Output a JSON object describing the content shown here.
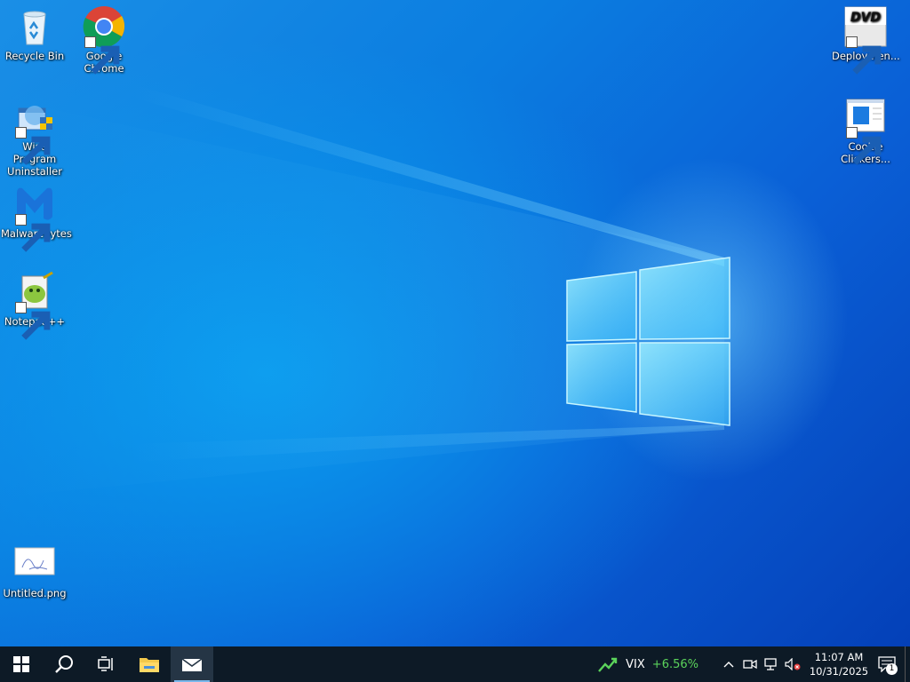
{
  "desktop": {
    "icons_left": [
      {
        "label": "Recycle Bin"
      },
      {
        "label": "Google Chrome"
      },
      {
        "label": "Wise Program Uninstaller"
      },
      {
        "label": "Malwarebytes"
      },
      {
        "label": "Notepad++"
      },
      {
        "label": "Untitled.png"
      }
    ],
    "icons_right": [
      {
        "label": "Deploymen..."
      },
      {
        "label": "Cookie Clickers..."
      }
    ]
  },
  "taskbar": {
    "widget": {
      "ticker": "VIX",
      "change": "+6.56%"
    },
    "clock": {
      "time": "11:07 AM",
      "date": "10/31/2025"
    },
    "notification_count": "1"
  },
  "colors": {
    "taskbar_bg": "#0d1a26",
    "widget_positive": "#5bd35b",
    "wallpaper_blue": "#0b7de0"
  }
}
